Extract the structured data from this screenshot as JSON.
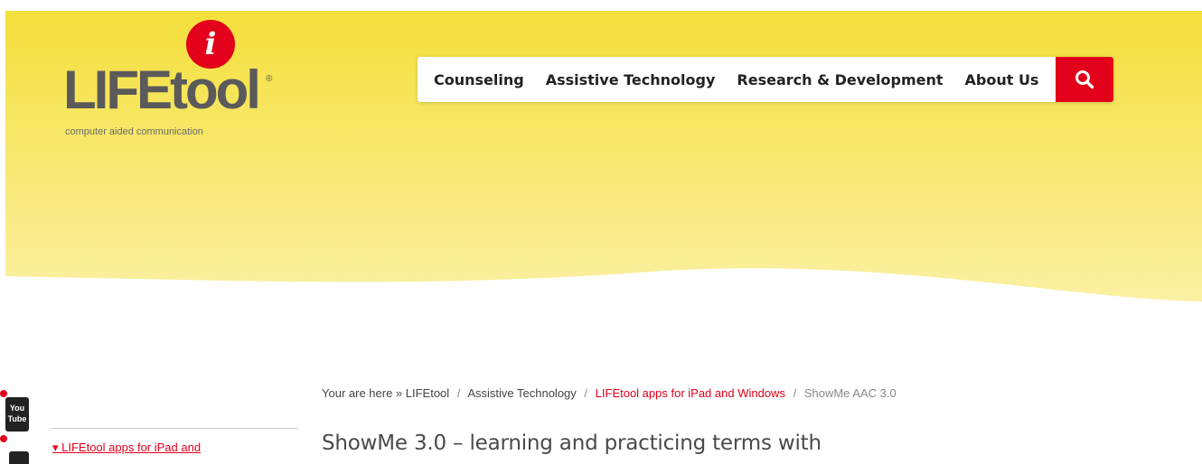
{
  "logo": {
    "mark": "i",
    "word": "LIFEtool",
    "registered": "®",
    "tagline": "computer aided communication"
  },
  "nav": {
    "items": [
      {
        "label": "Counseling"
      },
      {
        "label": "Assistive Technology"
      },
      {
        "label": "Research & Development"
      },
      {
        "label": "About Us"
      }
    ],
    "search_icon": "search-icon"
  },
  "breadcrumb": {
    "prefix": "Your are here »",
    "items": [
      "LIFEtool",
      "Assistive Technology",
      "LIFEtool apps for iPad and Windows"
    ],
    "current": "ShowMe AAC 3.0"
  },
  "sidebar": {
    "link": "▾ LIFEtool apps for iPad and"
  },
  "page": {
    "title": "ShowMe 3.0 – learning and practicing terms with"
  },
  "social": {
    "youtube_label": "You Tube"
  },
  "colors": {
    "brand_red": "#e2001a",
    "hero_yellow_top": "#f4df3a",
    "hero_yellow_bottom": "#fbf0a0"
  }
}
